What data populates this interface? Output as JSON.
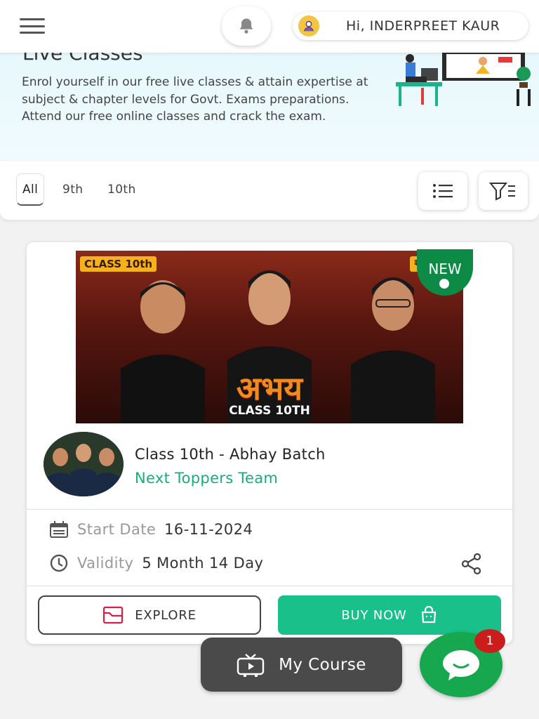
{
  "header": {
    "menu_icon": "hamburger-icon",
    "bell_icon": "bell-icon",
    "greeting": "Hi, INDERPREET KAUR"
  },
  "banner": {
    "title": "Live Classes",
    "description": "Enrol yourself in our free live classes & attain expertise at subject & chapter levels for Govt. Exams preparations. Attend our free online classes and crack the exam."
  },
  "filters": {
    "tabs": [
      {
        "label": "All",
        "active": true
      },
      {
        "label": "9th",
        "active": false
      },
      {
        "label": "10th",
        "active": false
      }
    ],
    "list_view_icon": "list-icon",
    "filter_icon": "filter-icon"
  },
  "course": {
    "thumbnail": {
      "badge": "CLASS 10th",
      "price_tag": "₹",
      "title": "अभय",
      "subtitle": "CLASS 10TH",
      "new_label": "NEW"
    },
    "name": "Class 10th - Abhay Batch",
    "team": "Next Toppers Team",
    "start_date_label": "Start Date",
    "start_date": "16-11-2024",
    "validity_label": "Validity",
    "validity": "5 Month 14 Day",
    "explore_label": "EXPLORE",
    "buy_label": "BUY NOW"
  },
  "bottom": {
    "my_course_label": "My Course",
    "chat_badge_count": "1"
  },
  "colors": {
    "accent_green": "#19c089",
    "team_green": "#14b07a",
    "chat_green": "#17a84f",
    "badge_red": "#cc1d1d"
  }
}
